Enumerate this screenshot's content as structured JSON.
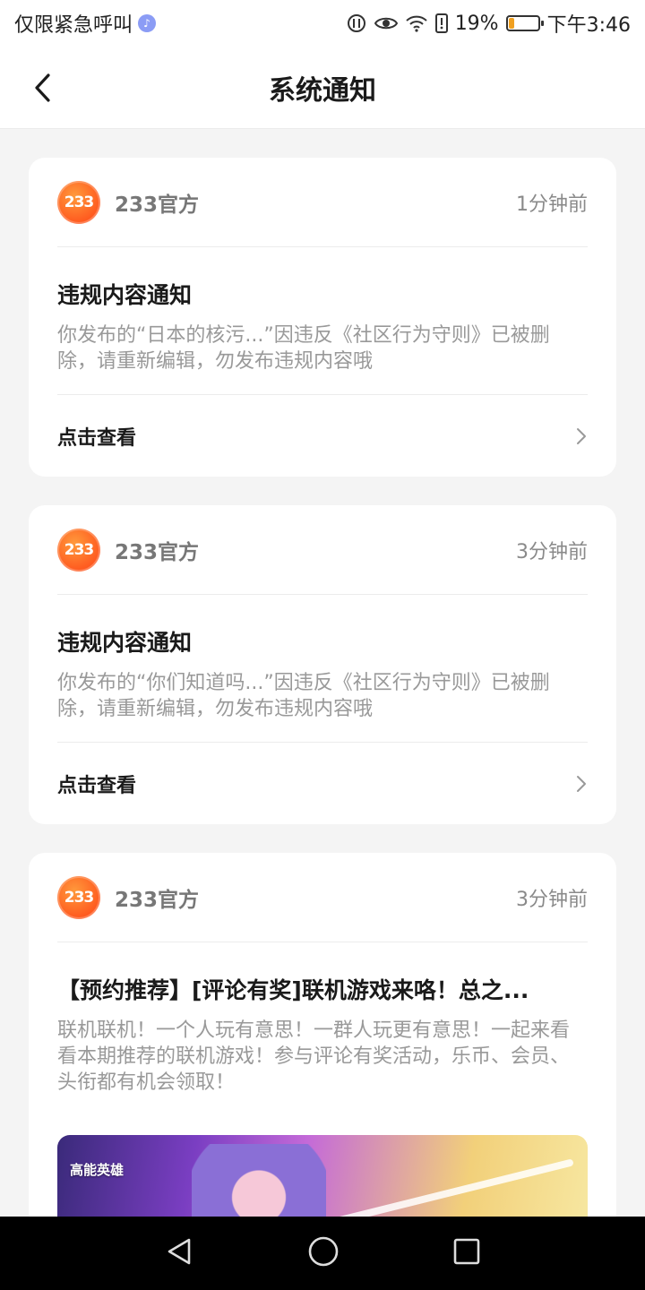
{
  "status_bar": {
    "left_text": "仅限紧急呼叫",
    "battery_percent": "19%",
    "battery_level": 0.19,
    "time": "下午3:46",
    "icons": [
      "music-icon",
      "data-icon",
      "eye-icon",
      "wifi-icon",
      "sim-icon",
      "battery-icon"
    ]
  },
  "header": {
    "title": "系统通知"
  },
  "notifications": [
    {
      "sender": "233官方",
      "avatar_text": "233",
      "time": "1分钟前",
      "title": "违规内容通知",
      "body": "你发布的“日本的核污...”因违反《社区行为守则》已被删除，请重新编辑，勿发布违规内容哦",
      "action": "点击查看"
    },
    {
      "sender": "233官方",
      "avatar_text": "233",
      "time": "3分钟前",
      "title": "违规内容通知",
      "body": "你发布的“你们知道吗...”因违反《社区行为守则》已被删除，请重新编辑，勿发布违规内容哦",
      "action": "点击查看"
    },
    {
      "sender": "233官方",
      "avatar_text": "233",
      "time": "3分钟前",
      "title": "【预约推荐】[评论有奖]联机游戏来咯！总之...",
      "body": "联机联机！一个人玩有意思！一群人玩更有意思！一起来看看本期推荐的联机游戏！参与评论有奖活动，乐币、会员、头衔都有机会领取！",
      "banner_logo": "高能英雄"
    }
  ],
  "colors": {
    "accent": "#ff6a22",
    "background": "#f4f4f4",
    "card": "#ffffff"
  }
}
